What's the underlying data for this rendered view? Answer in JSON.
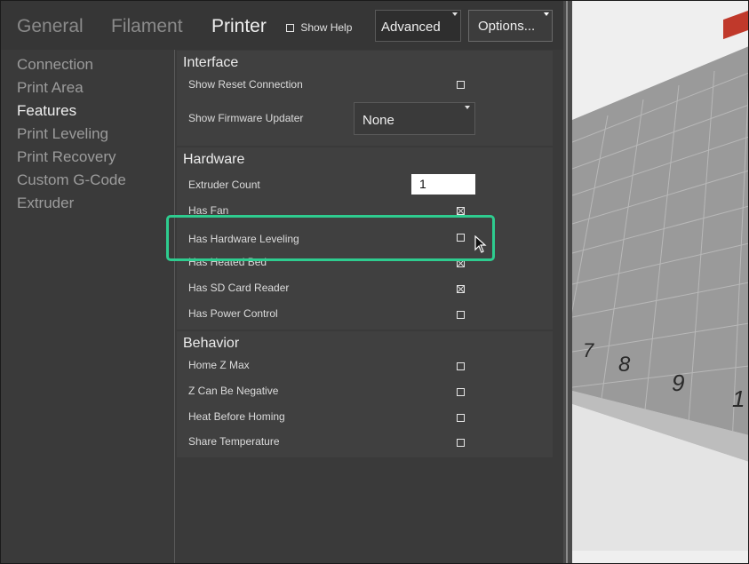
{
  "tabs": [
    {
      "label": "General"
    },
    {
      "label": "Filament"
    },
    {
      "label": "Printer"
    }
  ],
  "show_help": {
    "label": "Show Help"
  },
  "mode_select": {
    "value": "Advanced"
  },
  "options_select": {
    "value": "Options..."
  },
  "nav": [
    "Connection",
    "Print Area",
    "Features",
    "Print Leveling",
    "Print Recovery",
    "Custom G-Code",
    "Extruder"
  ],
  "interface": {
    "title": "Interface",
    "show_reset_connection": "Show Reset Connection",
    "show_firmware_updater": "Show Firmware Updater",
    "firmware_updater_value": "None"
  },
  "hardware": {
    "title": "Hardware",
    "extruder_count": "Extruder Count",
    "extruder_count_value": "1",
    "has_fan": "Has Fan",
    "has_hardware_leveling": "Has Hardware Leveling",
    "has_heated_bed": "Has Heated Bed",
    "has_sd_card_reader": "Has SD Card Reader",
    "has_power_control": "Has Power Control"
  },
  "behavior": {
    "title": "Behavior",
    "home_z_max": "Home Z Max",
    "z_can_be_negative": "Z Can Be Negative",
    "heat_before_homing": "Heat Before Homing",
    "share_temperature": "Share Temperature"
  },
  "bed_numbers": [
    "7",
    "8",
    "9",
    "1"
  ],
  "colors": {
    "highlight": "#2ecc8f",
    "bed_marker": "#c0392b"
  }
}
